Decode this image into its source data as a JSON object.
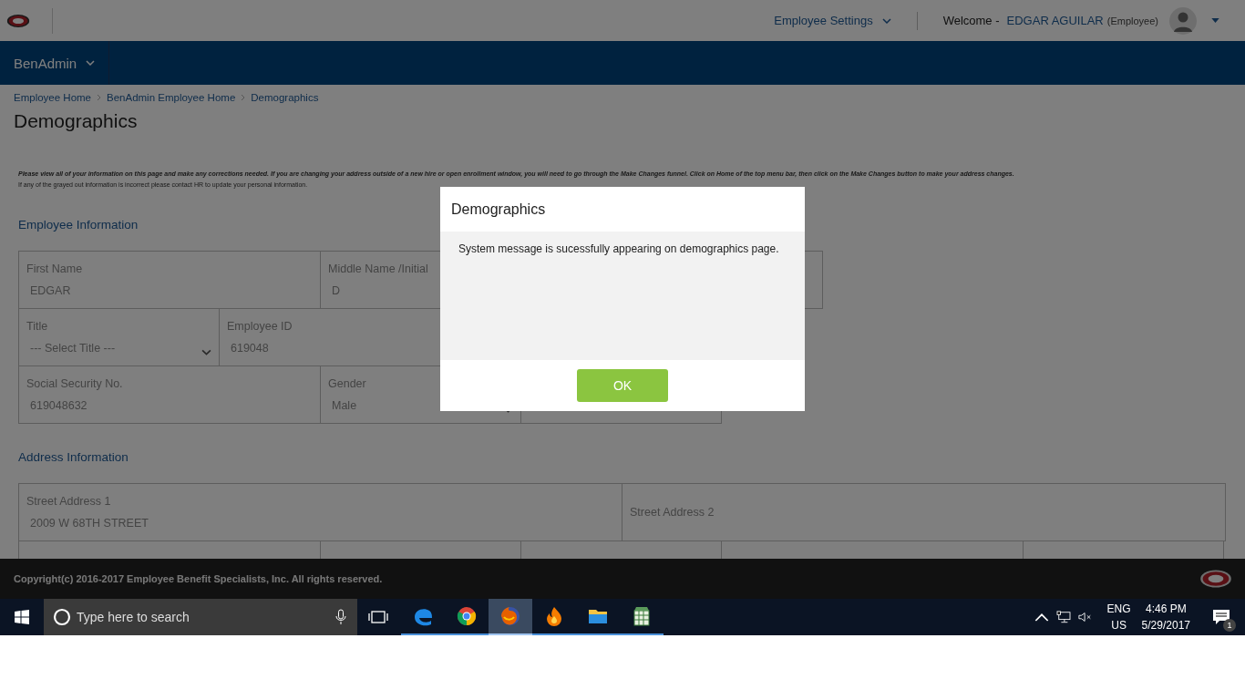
{
  "header": {
    "settings": "Employee Settings",
    "welcome": "Welcome -",
    "user": "EDGAR AGUILAR",
    "role": "(Employee)"
  },
  "nav": {
    "menu": "BenAdmin"
  },
  "breadcrumbs": [
    "Employee Home",
    "BenAdmin Employee Home",
    "Demographics"
  ],
  "page_title": "Demographics",
  "instructions": [
    "Please view all of your information on this page and make any corrections needed.  If you are changing your address outside of a new hire or open enrollment window, you will need to go through the Make Changes funnel.  Click on Home of the top menu bar, then click on the Make Changes button to make your address changes.",
    "If any of the grayed out information is incorrect please contact HR to update your personal information."
  ],
  "sections": [
    {
      "title": "Employee Information",
      "rows": [
        [
          {
            "label": "First Name",
            "value": "EDGAR",
            "kind": "text"
          },
          {
            "label": "Middle Name /Initial",
            "value": "D",
            "kind": "text"
          },
          {
            "kind": "blank"
          }
        ],
        [
          {
            "label": "Title",
            "value": "--- Select Title ---",
            "kind": "select"
          },
          {
            "label": "Employee ID",
            "value": "619048",
            "kind": "text"
          }
        ],
        [
          {
            "label": "Social Security No.",
            "value": "619048632",
            "kind": "text"
          },
          {
            "label": "Gender",
            "value": "Male",
            "kind": "select"
          },
          {
            "kind": "blank"
          }
        ]
      ]
    },
    {
      "title": "Address Information",
      "rows": [
        [
          {
            "label": "Street Address 1",
            "value": "2009 W 68TH STREET",
            "kind": "text"
          },
          {
            "label": "Street Address 2",
            "kind": "text"
          }
        ],
        [
          {
            "kind": "blank"
          },
          {
            "kind": "blank"
          },
          {
            "kind": "blank"
          },
          {
            "kind": "blank"
          },
          {
            "kind": "blank"
          }
        ]
      ]
    }
  ],
  "footer": {
    "copyright": "Copyright(c) 2016-2017 Employee Benefit Specialists, Inc. All rights reserved."
  },
  "dialog": {
    "title": "Demographics",
    "message": "System message is sucessfully appearing on demographics page.",
    "button": "OK"
  },
  "taskbar": {
    "search_placeholder": "Type here to search",
    "apps": [
      {
        "kind": "edge",
        "selected": false
      },
      {
        "kind": "chrome",
        "selected": false
      },
      {
        "kind": "firefox",
        "selected": true
      },
      {
        "kind": "flame",
        "selected": false
      },
      {
        "kind": "folder",
        "selected": false
      },
      {
        "kind": "sheet",
        "selected": false
      }
    ],
    "lang": "ENG",
    "region": "US",
    "time": "4:46 PM",
    "date": "5/29/2017",
    "notifications": "1"
  }
}
